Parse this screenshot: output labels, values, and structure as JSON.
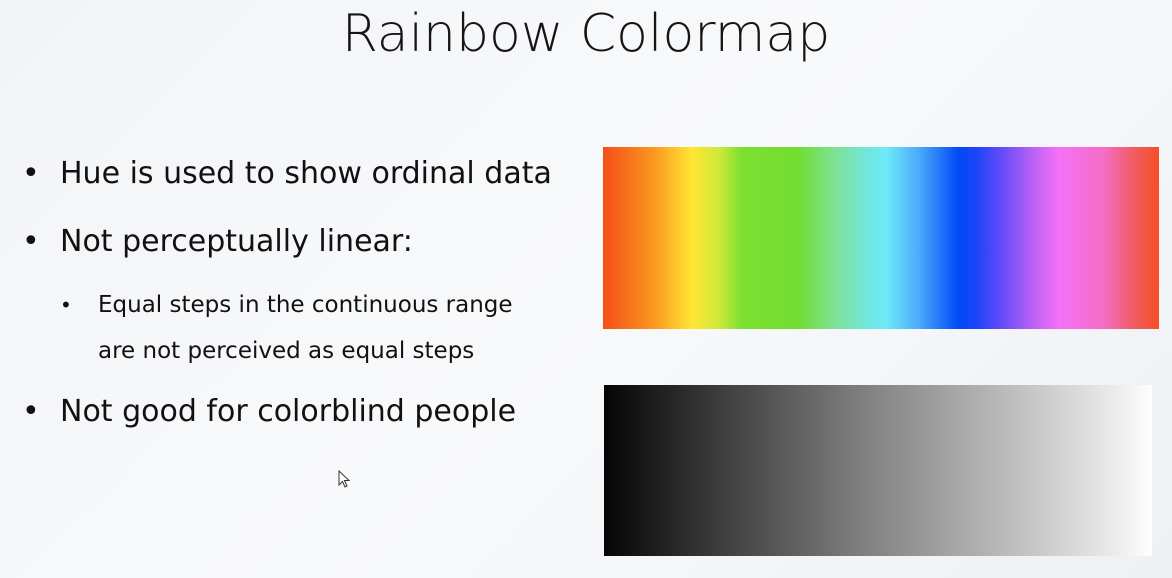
{
  "title": "Rainbow Colormap",
  "bullets": [
    {
      "text": "Hue is used to show ordinal data"
    },
    {
      "text": "Not perceptually linear:",
      "sub": [
        "Equal steps in the continuous range",
        "are not perceived as equal steps"
      ]
    },
    {
      "text": "Not good for colorblind people"
    }
  ],
  "bullet_glyph": "•",
  "colormaps": {
    "rainbow": [
      "#f84f18",
      "#ffe533",
      "#72dd30",
      "#6ceaf8",
      "#0049f6",
      "#f470f7",
      "#f74e24"
    ],
    "grayscale": [
      "#050505",
      "#fefefe"
    ]
  }
}
